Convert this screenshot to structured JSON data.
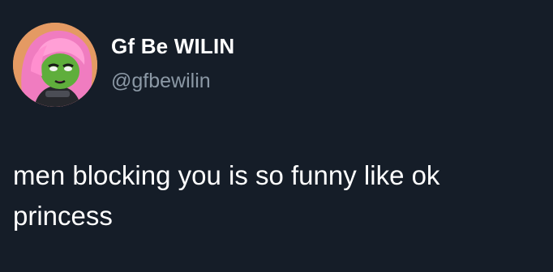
{
  "tweet": {
    "author": {
      "display_name": "Gf Be WILIN",
      "handle": "@gfbewilin",
      "avatar_icon": "pink-haired-green-character-avatar"
    },
    "text": "men blocking you is so funny like ok princess"
  },
  "colors": {
    "background": "#151d28",
    "text_primary": "#ffffff",
    "text_secondary": "#8b98a5"
  }
}
